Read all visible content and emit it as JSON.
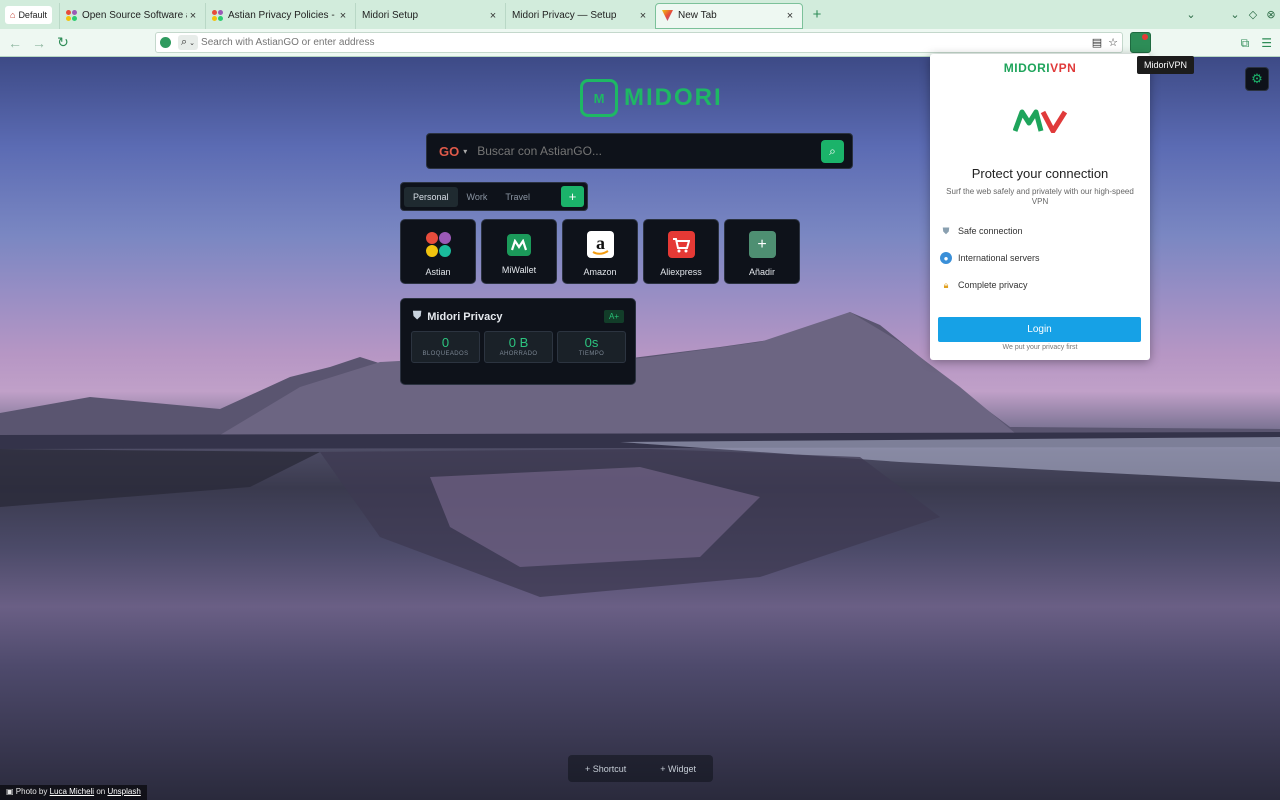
{
  "browser": {
    "profile_label": "Default",
    "tabs": [
      {
        "title": "Open Source Software and"
      },
      {
        "title": "Astian Privacy Policies - Ast"
      },
      {
        "title": "Midori Setup"
      },
      {
        "title": "Midori Privacy — Setup"
      },
      {
        "title": "New Tab"
      }
    ],
    "address_placeholder": "Search with AstianGO or enter address"
  },
  "newtab": {
    "logo_text": "MIDORI",
    "logo_badge": "M",
    "search": {
      "engine": "GO",
      "placeholder": "Buscar con AstianGO..."
    },
    "workspaces": [
      "Personal",
      "Work",
      "Travel"
    ],
    "add_label": "+",
    "shortcuts": [
      {
        "label": "Astian",
        "icon": "astian-icon"
      },
      {
        "label": "MiWallet",
        "icon": "miwallet-icon"
      },
      {
        "label": "Amazon",
        "icon": "amazon-icon"
      },
      {
        "label": "Aliexpress",
        "icon": "aliexpress-icon"
      },
      {
        "label": "Añadir",
        "icon": "plus-icon"
      }
    ],
    "privacy_widget": {
      "title": "Midori Privacy",
      "grade": "A+",
      "stats": [
        {
          "value": "0",
          "label": "BLOQUEADOS"
        },
        {
          "value": "0 B",
          "label": "AHORRADO"
        },
        {
          "value": "0s",
          "label": "TIEMPO"
        }
      ]
    },
    "bottom_bar": {
      "shortcut": "Shortcut",
      "widget": "Widget"
    },
    "credit": {
      "prefix": "Photo by",
      "author": "Luca Micheli",
      "on": "on",
      "site": "Unsplash"
    }
  },
  "vpn_popup": {
    "tooltip": "MidoriVPN",
    "brand_a": "MIDORI",
    "brand_b": "VPN",
    "title": "Protect your connection",
    "subtitle": "Surf the web safely and privately with our high-speed VPN",
    "features": [
      {
        "label": "Safe connection",
        "icon": "shield-icon"
      },
      {
        "label": "International servers",
        "icon": "globe-icon"
      },
      {
        "label": "Complete privacy",
        "icon": "lock-icon"
      }
    ],
    "login_label": "Login",
    "footer": "We put your privacy first"
  },
  "colors": {
    "accent": "#1bb36a",
    "login": "#16a1e6",
    "brand_red": "#e03a3a"
  }
}
